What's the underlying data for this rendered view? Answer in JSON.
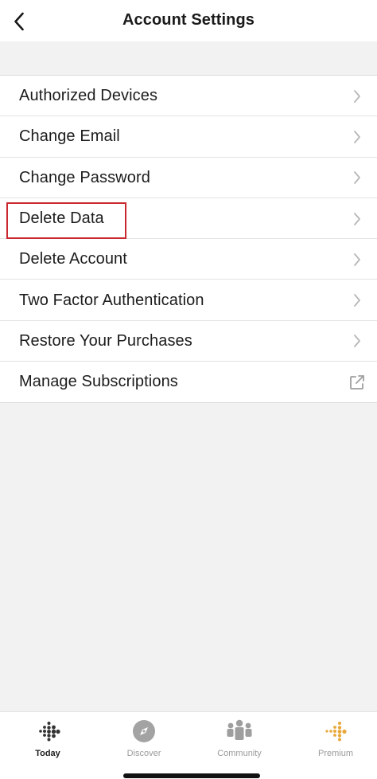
{
  "header": {
    "title": "Account Settings"
  },
  "settings": {
    "items": [
      {
        "label": "Authorized Devices",
        "trailing_icon": "chevron-right-icon"
      },
      {
        "label": "Change Email",
        "trailing_icon": "chevron-right-icon"
      },
      {
        "label": "Change Password",
        "trailing_icon": "chevron-right-icon"
      },
      {
        "label": "Delete Data",
        "trailing_icon": "chevron-right-icon",
        "highlighted": true
      },
      {
        "label": "Delete Account",
        "trailing_icon": "chevron-right-icon"
      },
      {
        "label": "Two Factor Authentication",
        "trailing_icon": "chevron-right-icon"
      },
      {
        "label": "Restore Your Purchases",
        "trailing_icon": "chevron-right-icon"
      },
      {
        "label": "Manage Subscriptions",
        "trailing_icon": "external-link-icon"
      }
    ]
  },
  "tab_bar": {
    "tabs": [
      {
        "label": "Today",
        "icon": "fitbit-dots-icon",
        "active": true
      },
      {
        "label": "Discover",
        "icon": "compass-icon",
        "active": false
      },
      {
        "label": "Community",
        "icon": "community-icon",
        "active": false
      },
      {
        "label": "Premium",
        "icon": "premium-dots-icon",
        "active": false
      }
    ]
  },
  "colors": {
    "highlight_border": "#c8282e",
    "premium_accent": "#e8a93a",
    "inactive_tab": "#9b9b9b",
    "background": "#f2f2f2"
  }
}
